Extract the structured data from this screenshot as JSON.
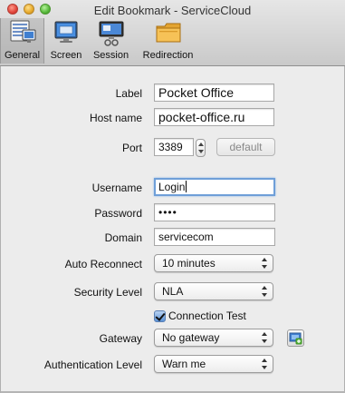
{
  "window": {
    "title": "Edit Bookmark - ServiceCloud"
  },
  "toolbar": {
    "tabs": [
      {
        "label": "General",
        "icon": "monitor-settings-icon",
        "active": true
      },
      {
        "label": "Screen",
        "icon": "screen-icon",
        "active": false
      },
      {
        "label": "Session",
        "icon": "session-icon",
        "active": false
      },
      {
        "label": "Redirection",
        "icon": "folder-icon",
        "active": false
      }
    ]
  },
  "form": {
    "label": {
      "label": "Label",
      "value": "Pocket Office"
    },
    "hostname": {
      "label": "Host name",
      "value": "pocket-office.ru"
    },
    "port": {
      "label": "Port",
      "value": "3389",
      "default_button": "default"
    },
    "username": {
      "label": "Username",
      "value": "Login"
    },
    "password": {
      "label": "Password",
      "value": "••••"
    },
    "domain": {
      "label": "Domain",
      "value": "servicecom"
    },
    "auto_reconnect": {
      "label": "Auto Reconnect",
      "value": "10 minutes"
    },
    "security_level": {
      "label": "Security Level",
      "value": "NLA"
    },
    "connection_test": {
      "label": "Connection Test",
      "checked": true
    },
    "gateway": {
      "label": "Gateway",
      "value": "No gateway",
      "edit_icon": "gateway-edit-icon"
    },
    "authentication_level": {
      "label": "Authentication Level",
      "value": "Warn me"
    }
  },
  "colors": {
    "focus_ring": "#6f9fd8",
    "checkbox_blue": "#5b92d6"
  }
}
